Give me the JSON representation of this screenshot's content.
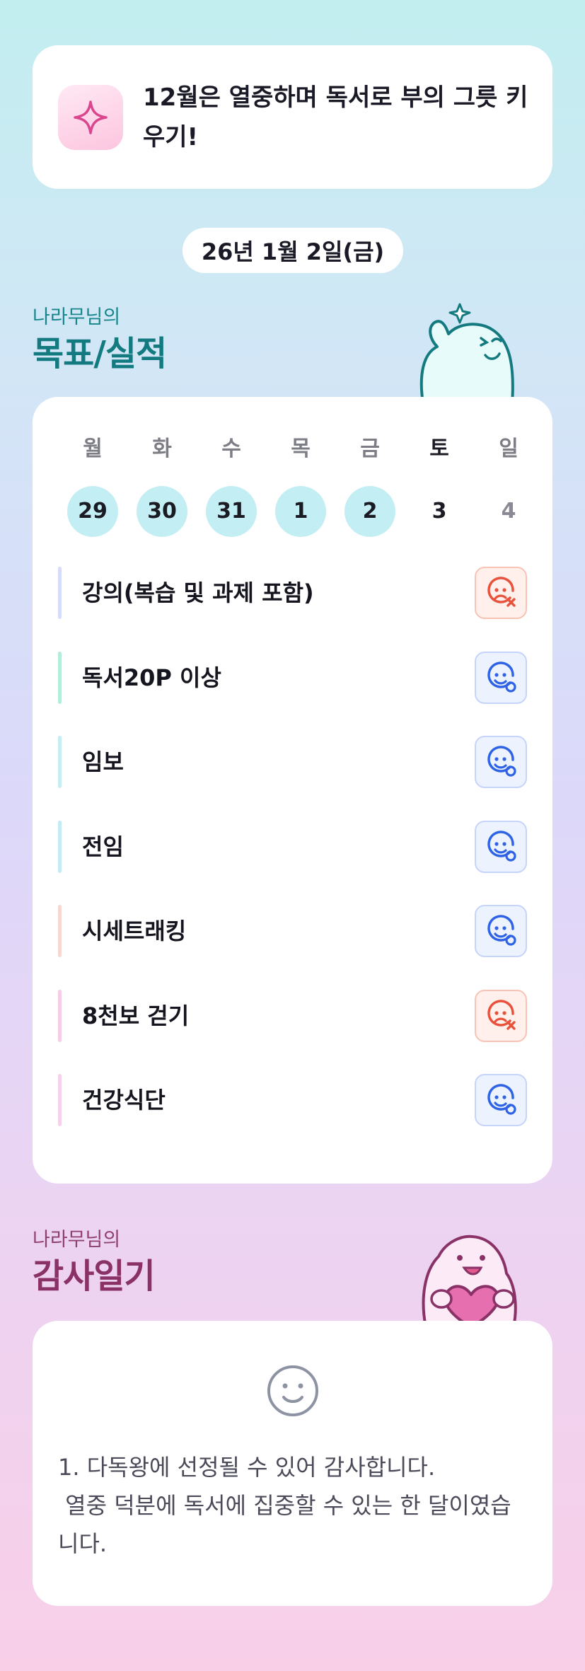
{
  "motto": {
    "text": "12월은 열중하며 독서로 부의 그릇 키우기!",
    "icon": "sparkle-icon"
  },
  "date": "26년 1월 2일(금)",
  "goals_section": {
    "owner": "나라무님의",
    "title": "목표/실적"
  },
  "week": {
    "days": [
      "월",
      "화",
      "수",
      "목",
      "금",
      "토",
      "일"
    ],
    "dates": [
      "29",
      "30",
      "31",
      "1",
      "2",
      "3",
      "4"
    ],
    "completed": [
      true,
      true,
      true,
      true,
      true,
      false,
      false
    ]
  },
  "goals": [
    {
      "label": "강의(복습 및 과제 포함)",
      "color": "#d6dcf9",
      "status": "fail"
    },
    {
      "label": "독서20P 이상",
      "color": "#b5eed8",
      "status": "ok"
    },
    {
      "label": "임보",
      "color": "#c5eef3",
      "status": "ok"
    },
    {
      "label": "전임",
      "color": "#c2ecf6",
      "status": "ok"
    },
    {
      "label": "시세트래킹",
      "color": "#f8d6d3",
      "status": "ok"
    },
    {
      "label": "8천보 걷기",
      "color": "#f7cde6",
      "status": "fail"
    },
    {
      "label": "건강식단",
      "color": "#f6d2ea",
      "status": "ok"
    }
  ],
  "thanks_section": {
    "owner": "나라무님의",
    "title": "감사일기"
  },
  "diary": {
    "text": "1. 다독왕에 선정될 수 있어 감사합니다.\n 열중 덕분에 독서에 집중할 수 있는 한 달이였습니다.",
    "icon": "smile-icon"
  },
  "colors": {
    "ok": "#2f63e6",
    "fail": "#e8523c",
    "goal_title": "#137a80",
    "thanks_title": "#8a3268"
  }
}
